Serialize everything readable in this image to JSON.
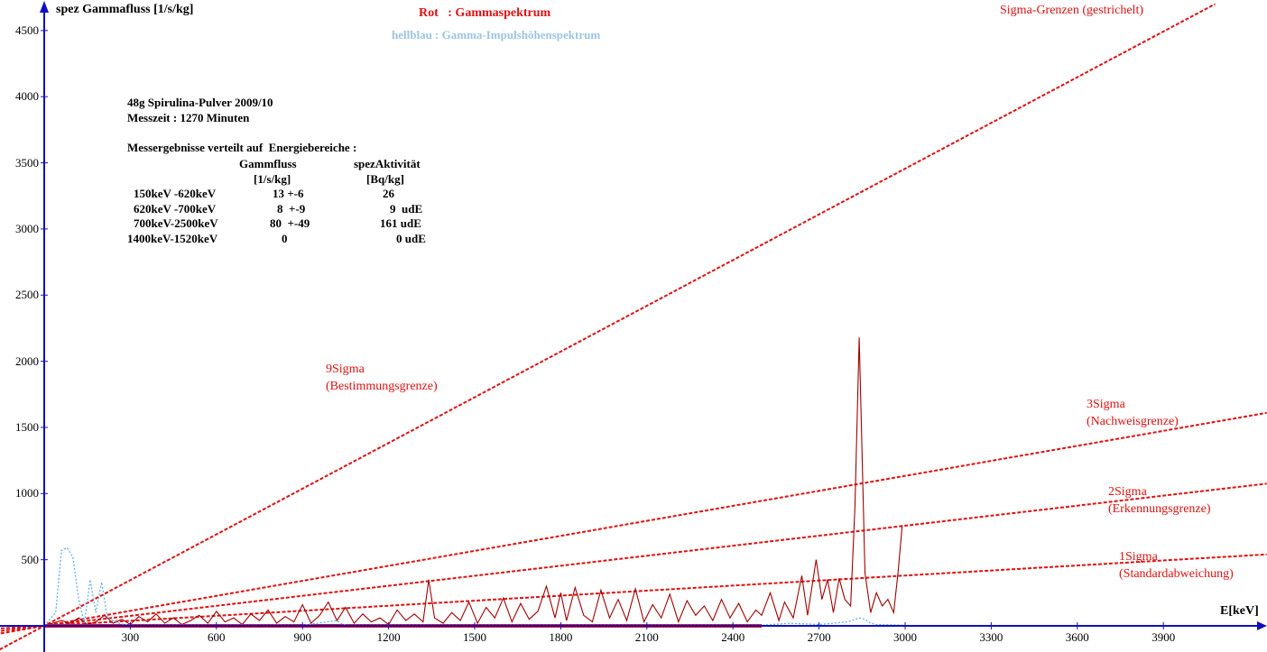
{
  "header": {
    "ylabel": "spez Gammafluss [1/s/kg]",
    "xlabel": "E[keV]",
    "legend_red": "Rot   : Gammaspektrum",
    "legend_blue": "hellblau : Gamma-Impulshöhenspektrum",
    "legend_sigma": "Sigma-Grenzen (gestrichelt)"
  },
  "info": {
    "sample": "48g Spirulina-Pulver 2009/10",
    "time": "Messzeit : 1270 Minuten",
    "results_title": "Messergebnisse verteilt auf  Energiebereiche :"
  },
  "table": {
    "col_flux": "Gammfluss",
    "col_act": "spezAktivität",
    "unit_flux": "[1/s/kg]",
    "unit_act": "[Bq/kg]",
    "rows": [
      {
        "range": "150keV -620keV",
        "flux": "13 +-6",
        "act": "26"
      },
      {
        "range": "620keV -700keV",
        "flux": "8  +-9",
        "act": "9  udE"
      },
      {
        "range": "700keV-2500keV",
        "flux": "80  +-49",
        "act": "161 udE"
      },
      {
        "range": "1400keV-1520keV",
        "flux": "0",
        "act": "0 udE"
      }
    ]
  },
  "sigma_labels": {
    "s9_a": "9Sigma",
    "s9_b": "(Bestimmungsgrenze)",
    "s3_a": "3Sigma",
    "s3_b": "(Nachweisgrenze)",
    "s2_a": "2Sigma",
    "s2_b": "(Erkennungsgrenze)",
    "s1_a": "1Sigma",
    "s1_b": "(Standardabweichung)"
  },
  "colors": {
    "red": "#e01010",
    "darkred": "#a00000",
    "blue": "#3a78d0",
    "lightblue": "#5aa8e8",
    "axis": "#1010c0"
  },
  "chart_data": {
    "type": "line",
    "xlabel": "E[keV]",
    "ylabel": "spez Gammafluss [1/s/kg]",
    "xlim": [
      -150,
      4250
    ],
    "ylim": [
      -200,
      4600
    ],
    "x_ticks": [
      300,
      600,
      900,
      1200,
      1500,
      1800,
      2100,
      2400,
      2700,
      3000,
      3300,
      3600,
      3900
    ],
    "y_ticks": [
      500,
      1000,
      1500,
      2000,
      2500,
      3000,
      3500,
      4000,
      4500
    ],
    "sigma_lines": [
      {
        "name": "9Sigma",
        "x": [
          0,
          4080
        ],
        "y": [
          0,
          4700
        ]
      },
      {
        "name": "3Sigma",
        "x": [
          0,
          4260
        ],
        "y": [
          0,
          1610
        ]
      },
      {
        "name": "2Sigma",
        "x": [
          0,
          4260
        ],
        "y": [
          0,
          1075
        ]
      },
      {
        "name": "1Sigma",
        "x": [
          0,
          4260
        ],
        "y": [
          0,
          540
        ]
      }
    ],
    "series": [
      {
        "name": "Gammaspektrum",
        "x": [
          0,
          60,
          90,
          120,
          150,
          180,
          210,
          240,
          270,
          300,
          330,
          360,
          390,
          420,
          450,
          480,
          510,
          540,
          570,
          600,
          630,
          660,
          690,
          720,
          750,
          780,
          810,
          840,
          870,
          900,
          930,
          960,
          990,
          1020,
          1050,
          1080,
          1110,
          1140,
          1170,
          1200,
          1230,
          1260,
          1290,
          1320,
          1340,
          1360,
          1390,
          1420,
          1450,
          1480,
          1510,
          1540,
          1570,
          1600,
          1630,
          1660,
          1690,
          1720,
          1750,
          1780,
          1800,
          1820,
          1850,
          1880,
          1910,
          1940,
          1970,
          2000,
          2030,
          2060,
          2090,
          2120,
          2150,
          2180,
          2210,
          2240,
          2270,
          2300,
          2330,
          2360,
          2390,
          2420,
          2450,
          2480,
          2500,
          2530,
          2560,
          2580,
          2610,
          2640,
          2660,
          2690,
          2710,
          2730,
          2750,
          2770,
          2790,
          2810,
          2825,
          2840,
          2850,
          2860,
          2880,
          2900,
          2920,
          2940,
          2960,
          2975,
          2990
        ],
        "y": [
          0,
          40,
          20,
          60,
          10,
          30,
          80,
          20,
          50,
          10,
          70,
          30,
          90,
          20,
          60,
          10,
          40,
          80,
          20,
          110,
          30,
          60,
          10,
          90,
          40,
          120,
          20,
          70,
          30,
          160,
          20,
          80,
          180,
          40,
          140,
          20,
          90,
          30,
          60,
          10,
          120,
          40,
          90,
          30,
          350,
          60,
          20,
          100,
          40,
          180,
          20,
          140,
          60,
          210,
          30,
          170,
          50,
          110,
          300,
          60,
          250,
          40,
          290,
          80,
          30,
          270,
          60,
          200,
          40,
          280,
          30,
          160,
          60,
          240,
          30,
          190,
          80,
          150,
          40,
          200,
          60,
          170,
          30,
          120,
          80,
          250,
          40,
          180,
          60,
          380,
          80,
          500,
          200,
          350,
          100,
          360,
          200,
          150,
          900,
          2180,
          1300,
          400,
          100,
          250,
          150,
          200,
          100,
          400,
          760
        ]
      },
      {
        "name": "Gammaspektrum-Untergrund",
        "x": [
          0,
          2500
        ],
        "y": [
          0,
          0
        ]
      },
      {
        "name": "Gamma-Impulshöhenspektrum",
        "x": [
          0,
          40,
          60,
          80,
          100,
          120,
          140,
          160,
          180,
          200,
          220,
          240,
          260,
          280,
          300,
          900,
          1020,
          1040,
          1060,
          2500,
          2600,
          2700,
          2800,
          2840,
          2860,
          2880,
          2900,
          3000
        ],
        "y": [
          0,
          100,
          570,
          590,
          520,
          200,
          20,
          350,
          100,
          330,
          60,
          40,
          20,
          10,
          5,
          5,
          40,
          10,
          5,
          5,
          20,
          10,
          30,
          60,
          50,
          20,
          10,
          5
        ]
      }
    ]
  }
}
